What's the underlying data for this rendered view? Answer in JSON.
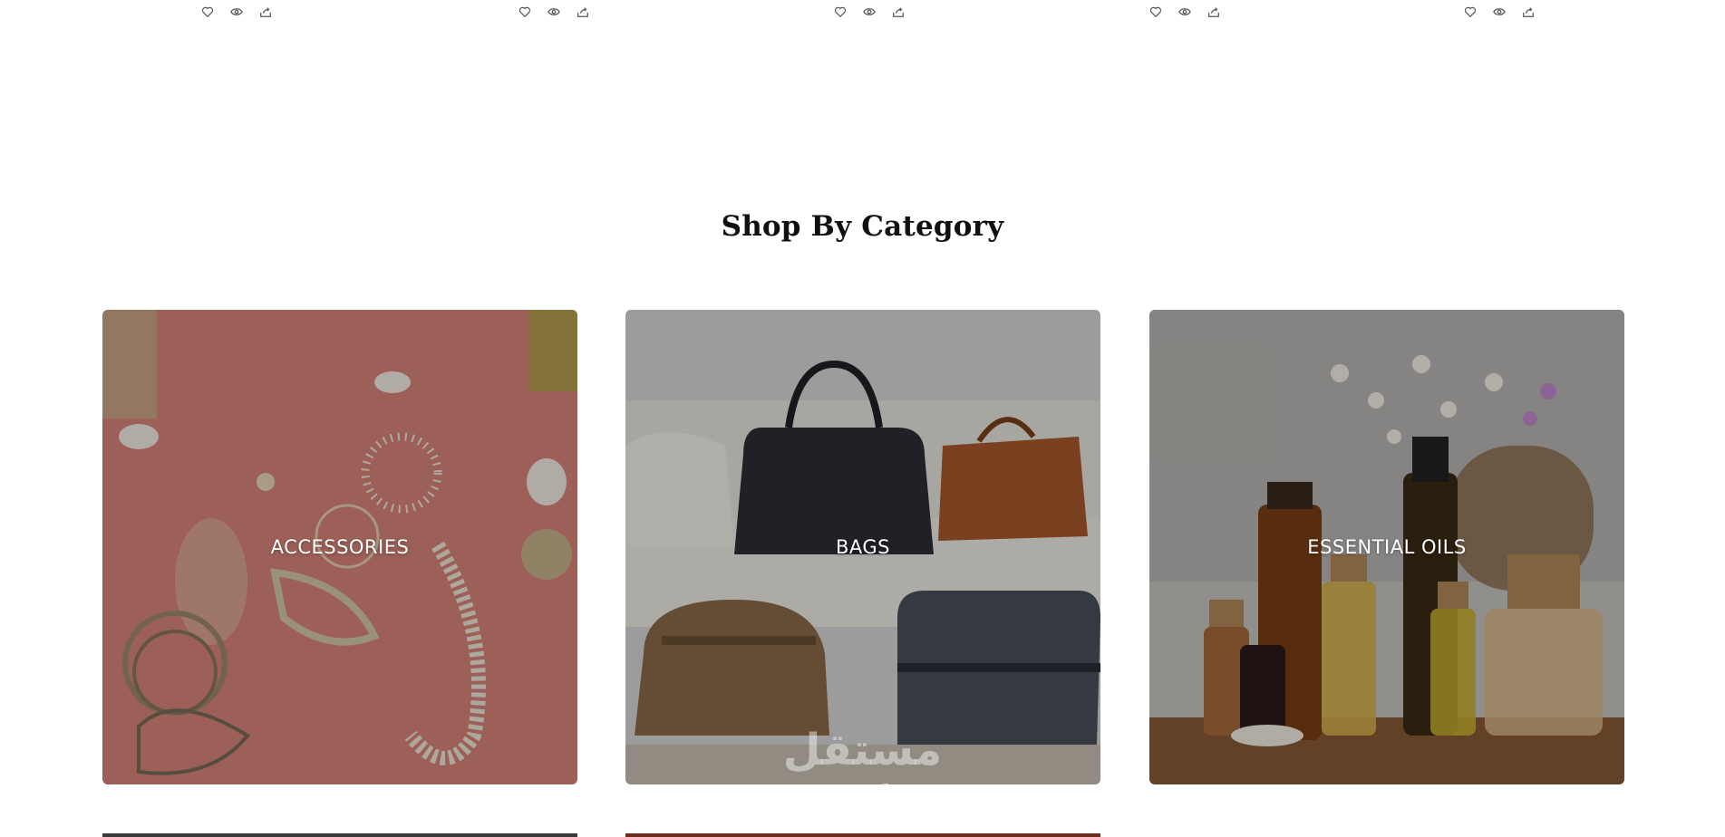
{
  "product_actions": [
    {
      "icons": [
        "heart-icon",
        "eye-icon",
        "share-icon"
      ]
    },
    {
      "icons": [
        "heart-icon",
        "eye-icon",
        "share-icon"
      ]
    },
    {
      "icons": [
        "heart-icon",
        "eye-icon",
        "share-icon"
      ]
    },
    {
      "icons": [
        "heart-icon",
        "eye-icon",
        "share-icon"
      ]
    },
    {
      "icons": [
        "heart-icon",
        "eye-icon",
        "share-icon"
      ]
    }
  ],
  "section": {
    "title": "Shop By Category"
  },
  "categories": [
    {
      "label": "ACCESSORIES"
    },
    {
      "label": "BAGS"
    },
    {
      "label": "ESSENTIAL OILS"
    }
  ],
  "watermark": {
    "logo_text": "مستقل",
    "domain": "mostaql.com"
  },
  "colors": {
    "title": "#111111",
    "label": "#ffffff",
    "icon_stroke": "#555555"
  }
}
